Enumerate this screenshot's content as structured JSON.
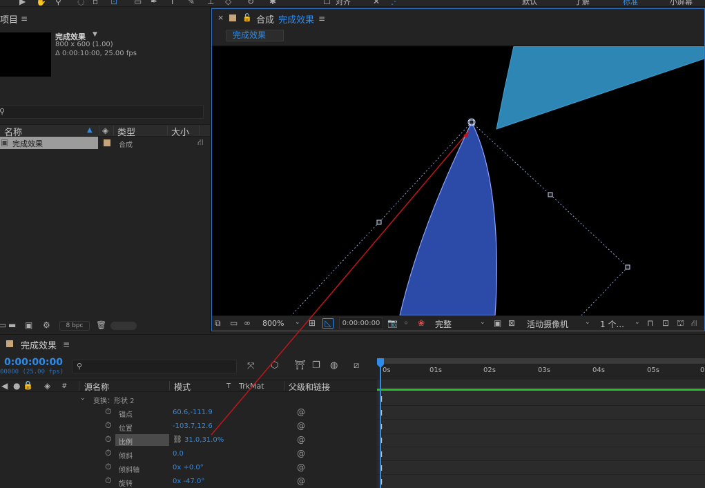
{
  "toolbar": {
    "right_items": [
      "对齐",
      "默认",
      "了解",
      "标准",
      "小屏幕"
    ]
  },
  "project": {
    "title": "项目",
    "comp_name": "完成效果",
    "comp_size": "800 x 600 (1.00)",
    "comp_duration": "Δ 0:00:10:00, 25.00 fps",
    "columns": {
      "name": "名称",
      "type": "类型",
      "size": "大小"
    },
    "item": {
      "name": "完成效果",
      "type": "合成"
    },
    "bit_depth": "8 bpc"
  },
  "viewer": {
    "tab_prefix": "合成",
    "tab_comp": "完成效果",
    "chip": "完成效果",
    "zoom": "800%",
    "timecode": "0:00:00:00",
    "resolution": "完整",
    "camera": "活动摄像机",
    "views": "1 个...",
    "colors": {
      "teal_shape": "#2e86b4",
      "blue_shape": "#2c4aa8",
      "motion_arrow": "#c0161b"
    }
  },
  "timeline": {
    "tab_title": "完成效果",
    "current_time": "0:00:00:00",
    "fps": "00000 (25.00 fps)",
    "columns": {
      "hash": "#",
      "source": "源名称",
      "mode": "模式",
      "t": "T",
      "trkmat": "TrkMat",
      "parent": "父级和链接"
    },
    "group": "变换：形状 2",
    "properties": [
      {
        "name": "锚点",
        "value": "60.6,-111.9"
      },
      {
        "name": "位置",
        "value": "-103.7,12.6"
      },
      {
        "name": "比例",
        "value": "31.0,31.0%"
      },
      {
        "name": "倾斜",
        "value": "0.0"
      },
      {
        "name": "倾斜轴",
        "value": "0x +0.0°"
      },
      {
        "name": "旋转",
        "value": "0x -47.0°"
      }
    ],
    "ruler": [
      "0s",
      "01s",
      "02s",
      "03s",
      "04s",
      "05s",
      "0"
    ],
    "work_area_color": "#26c126"
  }
}
